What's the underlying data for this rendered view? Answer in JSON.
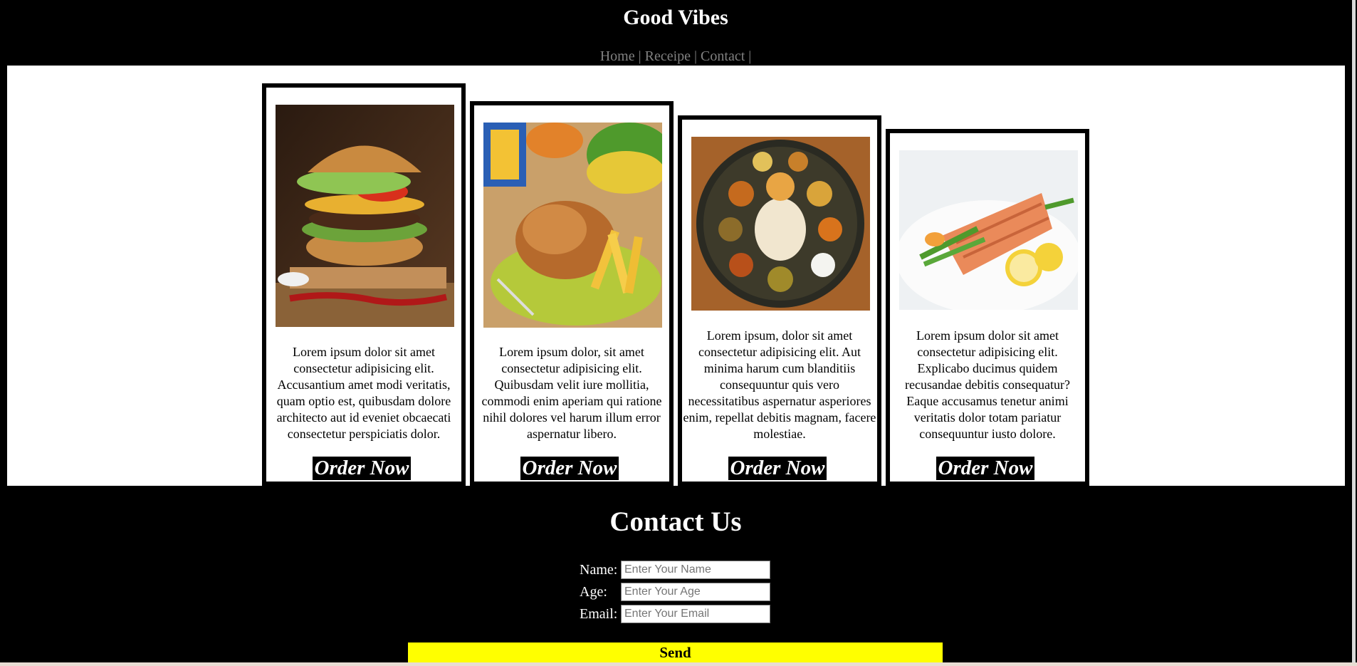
{
  "header": {
    "title": "Good Vibes",
    "nav": [
      {
        "label": "Home"
      },
      {
        "label": "Receipe"
      },
      {
        "label": "Contact"
      }
    ],
    "separator": "|"
  },
  "cards": [
    {
      "image": "burger-photo",
      "description": "Lorem ipsum dolor sit amet consectetur adipisicing elit. Accusantium amet modi veritatis, quam optio est, quibusdam dolore architecto aut id eveniet obcaecati consectetur perspiciatis dolor.",
      "button": "Order Now"
    },
    {
      "image": "chicken-fries-photo",
      "description": "Lorem ipsum dolor, sit amet consectetur adipisicing elit. Quibusdam velit iure mollitia, commodi enim aperiam qui ratione nihil dolores vel harum illum error aspernatur libero.",
      "button": "Order Now"
    },
    {
      "image": "thali-photo",
      "description": "Lorem ipsum, dolor sit amet consectetur adipisicing elit. Aut minima harum cum blanditiis consequuntur quis vero necessitatibus aspernatur asperiores enim, repellat debitis magnam, facere molestiae.",
      "button": "Order Now"
    },
    {
      "image": "salmon-photo",
      "description": "Lorem ipsum dolor sit amet consectetur adipisicing elit. Explicabo ducimus quidem recusandae debitis consequatur? Eaque accusamus tenetur animi veritatis dolor totam pariatur consequuntur iusto dolore.",
      "button": "Order Now"
    }
  ],
  "contact": {
    "title": "Contact Us",
    "fields": [
      {
        "label": "Name:",
        "placeholder": "Enter Your Name",
        "value": ""
      },
      {
        "label": "Age:",
        "placeholder": "Enter Your Age",
        "value": ""
      },
      {
        "label": "Email:",
        "placeholder": "Enter Your Email",
        "value": ""
      }
    ],
    "submit": "Send"
  },
  "colors": {
    "page_background": "#000000",
    "content_background": "#ffffff",
    "nav_text": "#808080",
    "send_button": "#ffff00"
  }
}
